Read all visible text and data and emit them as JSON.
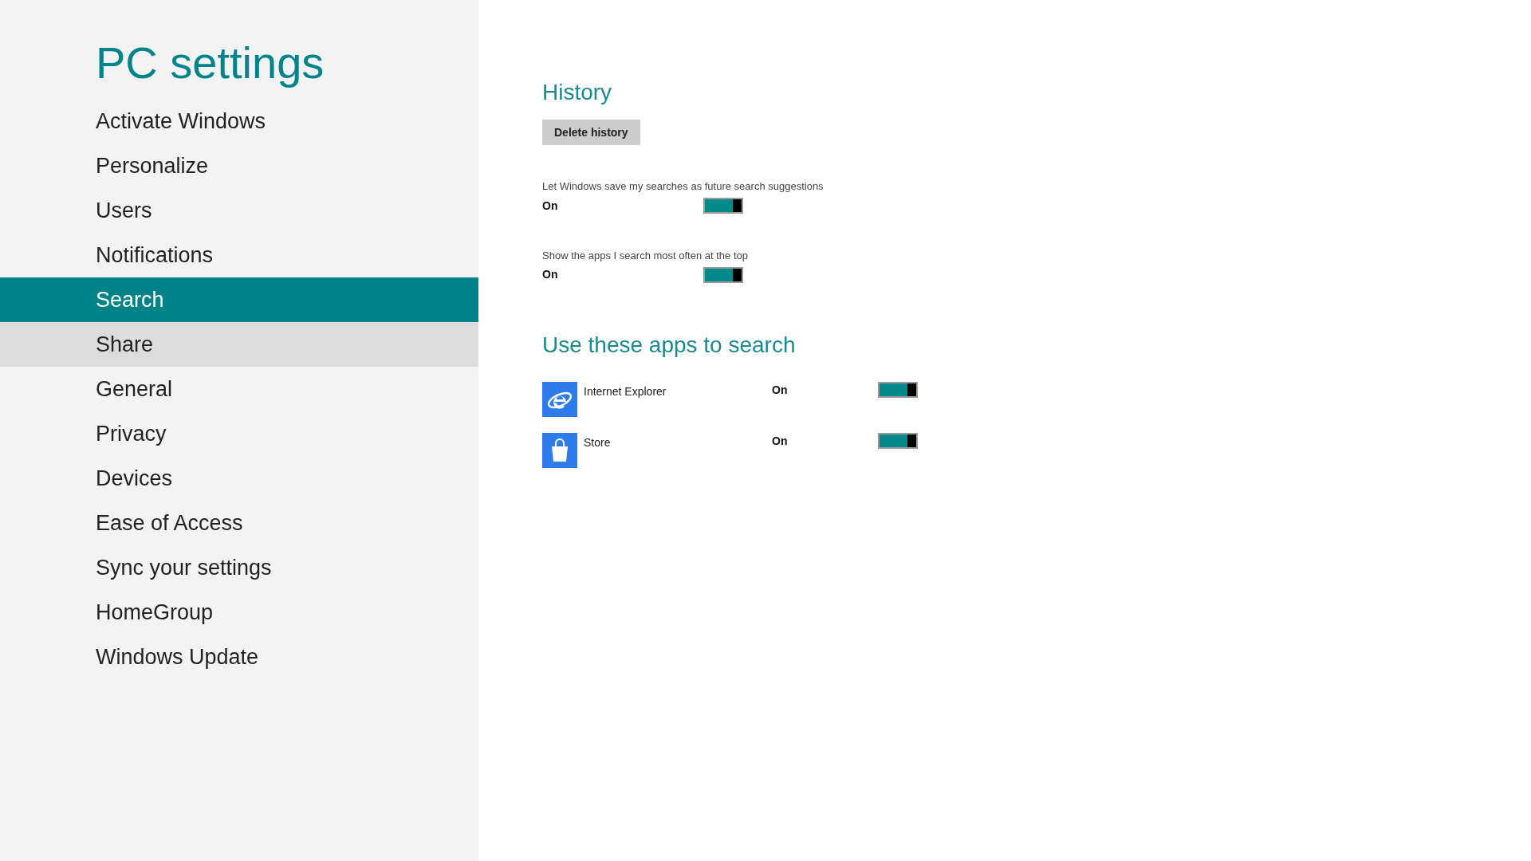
{
  "title": "PC settings",
  "nav": [
    {
      "label": "Activate Windows",
      "selected": false,
      "hovered": false
    },
    {
      "label": "Personalize",
      "selected": false,
      "hovered": false
    },
    {
      "label": "Users",
      "selected": false,
      "hovered": false
    },
    {
      "label": "Notifications",
      "selected": false,
      "hovered": false
    },
    {
      "label": "Search",
      "selected": true,
      "hovered": false
    },
    {
      "label": "Share",
      "selected": false,
      "hovered": true
    },
    {
      "label": "General",
      "selected": false,
      "hovered": false
    },
    {
      "label": "Privacy",
      "selected": false,
      "hovered": false
    },
    {
      "label": "Devices",
      "selected": false,
      "hovered": false
    },
    {
      "label": "Ease of Access",
      "selected": false,
      "hovered": false
    },
    {
      "label": "Sync your settings",
      "selected": false,
      "hovered": false
    },
    {
      "label": "HomeGroup",
      "selected": false,
      "hovered": false
    },
    {
      "label": "Windows Update",
      "selected": false,
      "hovered": false
    }
  ],
  "history": {
    "heading": "History",
    "button": "Delete history",
    "settings": [
      {
        "label": "Let Windows save my searches as future search suggestions",
        "state": "On",
        "on": true
      },
      {
        "label": "Show the apps I search most often at the top",
        "state": "On",
        "on": true
      }
    ]
  },
  "apps_section": {
    "heading": "Use these apps to search",
    "apps": [
      {
        "kind": "browser",
        "name": "Internet Explorer",
        "state": "On",
        "on": true
      },
      {
        "kind": "store",
        "name": "Store",
        "state": "On",
        "on": true
      }
    ]
  }
}
